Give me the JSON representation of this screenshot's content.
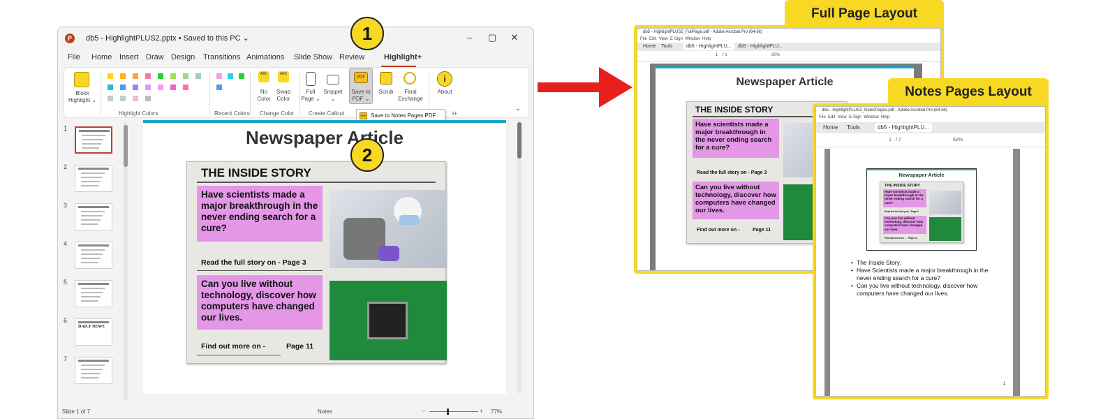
{
  "ppt": {
    "title": "db5 - HighlightPLUS2.pptx • Saved to this PC ⌄",
    "logo": "P",
    "win_min": "–",
    "win_max": "▢",
    "win_close": "✕",
    "menu": [
      "File",
      "Home",
      "Insert",
      "Draw",
      "Design",
      "Transitions",
      "Animations",
      "Slide Show",
      "Review",
      "Highlight+"
    ],
    "ribbon": {
      "block_highlight": "Block Highlight ⌄",
      "highlight_colors": "Highlight Colors",
      "recent_colors": "Recent Colors",
      "no_color": "No Color",
      "swap_color": "Swap Color",
      "change_color": "Change Color",
      "full_page": "Full Page ⌄",
      "snippet": "Snippet ⌄",
      "create_callout": "Create Callout",
      "save_to_pdf": "Save to PDF ⌄",
      "scrub": "Scrub",
      "final_exchange": "Final Exchange",
      "about": "About",
      "pdf_icon_text": "PDF",
      "abc": "ABC",
      "group_tail": "t+",
      "collapse": "⌄"
    },
    "dropdown_item": "Save to Notes Pages PDF",
    "slide_numbers": [
      "1",
      "2",
      "3",
      "4",
      "5",
      "6",
      "7"
    ],
    "thumb_6_text": "DAILY NEWS",
    "slide": {
      "title": "Newspaper Article",
      "headline": "THE INSIDE STORY",
      "story1": "Have scientists made a major breakthrough in the never ending search for a cure?",
      "read_more": "Read the full story on -  Page 3",
      "story2": "Can you live without technology, discover how computers have changed our lives.",
      "find_more": "Find out more on -",
      "find_page": "Page 11"
    },
    "status": {
      "slide_count": "Slide 1 of 7",
      "notes": "Notes",
      "zoom": "77%",
      "minus": "–",
      "plus": "+"
    }
  },
  "callouts": [
    "1",
    "2"
  ],
  "arrow_color": "#e8201d",
  "accent_yellow": "#f7d823",
  "full_page": {
    "label": "Full Page Layout",
    "title": "db5 - HighlightPLUS2_FullPage.pdf - Adobe Acrobat Pro (64-bit)",
    "menu": [
      "File",
      "Edit",
      "View",
      "E-Sign",
      "Window",
      "Help"
    ],
    "tabs": [
      "Home",
      "Tools",
      "db5 - HighlightPLU...",
      "db5 - HighlightPLU..."
    ],
    "page": "1",
    "pages": "/ 1",
    "zoom": "80%",
    "slide_title": "Newspaper Article",
    "headline": "THE INSIDE STORY",
    "story1": "Have scientists made a major breakthrough in the never ending search for a cure?",
    "read_more": "Read the full story on -  Page 3",
    "story2": "Can you live without technology, discover how computers have changed our lives.",
    "find_more": "Find out more on -",
    "find_page": "Page 11"
  },
  "notes_page": {
    "label": "Notes Pages Layout",
    "title": "db5 - HighlightPLUS2_NotesPages.pdf - Adobe Acrobat Pro (64-bit)",
    "menu": [
      "File",
      "Edit",
      "View",
      "E-Sign",
      "Window",
      "Help"
    ],
    "tabs": [
      "Home",
      "Tools",
      "db5 - HighlightPLU..."
    ],
    "page": "1",
    "pages": "/ 7",
    "zoom": "62%",
    "page_number": "1",
    "slide_title": "Newspaper Article",
    "headline": "THE INSIDE STORY",
    "story1": "Have scientists made a major breakthrough in the never ending search for a cure?",
    "read_more": "Read the full story on -  Page 3",
    "story2": "Can you live without technology, discover how computers have changed our lives.",
    "find_more": "Find out more on -",
    "find_page": "Page 11",
    "notes": [
      "The Inside Story:",
      "Have Scientists made a major breakthrough in the never ending search for a cure?",
      "Can you live without technology, discover how computers have changed our lives."
    ]
  }
}
